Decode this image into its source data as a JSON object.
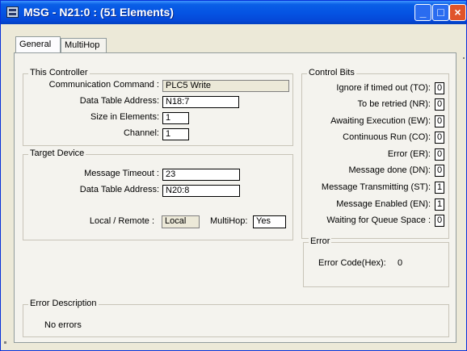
{
  "window": {
    "title": "MSG - N21:0 : (51 Elements)"
  },
  "tabs": [
    {
      "label": "General"
    },
    {
      "label": "MultiHop"
    }
  ],
  "this_controller": {
    "legend": "This Controller",
    "communication_command": {
      "label": "Communication Command :",
      "value": "PLC5 Write"
    },
    "data_table_address": {
      "label": "Data Table Address:",
      "value": "N18:7"
    },
    "size_in_elements": {
      "label": "Size in Elements:",
      "value": "1"
    },
    "channel": {
      "label": "Channel:",
      "value": "1"
    }
  },
  "target_device": {
    "legend": "Target Device",
    "message_timeout": {
      "label": "Message Timeout :",
      "value": "23"
    },
    "data_table_address": {
      "label": "Data Table Address:",
      "value": "N20:8"
    },
    "local_remote": {
      "label": "Local / Remote :",
      "value": "Local"
    },
    "multihop": {
      "label": "MultiHop:",
      "value": "Yes"
    }
  },
  "control_bits": {
    "legend": "Control Bits",
    "items": [
      {
        "label": "Ignore if timed out (TO):",
        "value": "0"
      },
      {
        "label": "To be retried (NR):",
        "value": "0"
      },
      {
        "label": "Awaiting Execution (EW):",
        "value": "0"
      },
      {
        "label": "Continuous Run (CO):",
        "value": "0"
      },
      {
        "label": "Error (ER):",
        "value": "0"
      },
      {
        "label": "Message done (DN):",
        "value": "0"
      },
      {
        "label": "Message Transmitting (ST):",
        "value": "1"
      },
      {
        "label": "Message Enabled (EN):",
        "value": "1"
      },
      {
        "label": "Waiting for Queue Space :",
        "value": "0"
      }
    ]
  },
  "error": {
    "legend": "Error",
    "code_label": "Error Code(Hex):",
    "code_value": "0"
  },
  "error_description": {
    "legend": "Error Description",
    "text": "No errors"
  }
}
